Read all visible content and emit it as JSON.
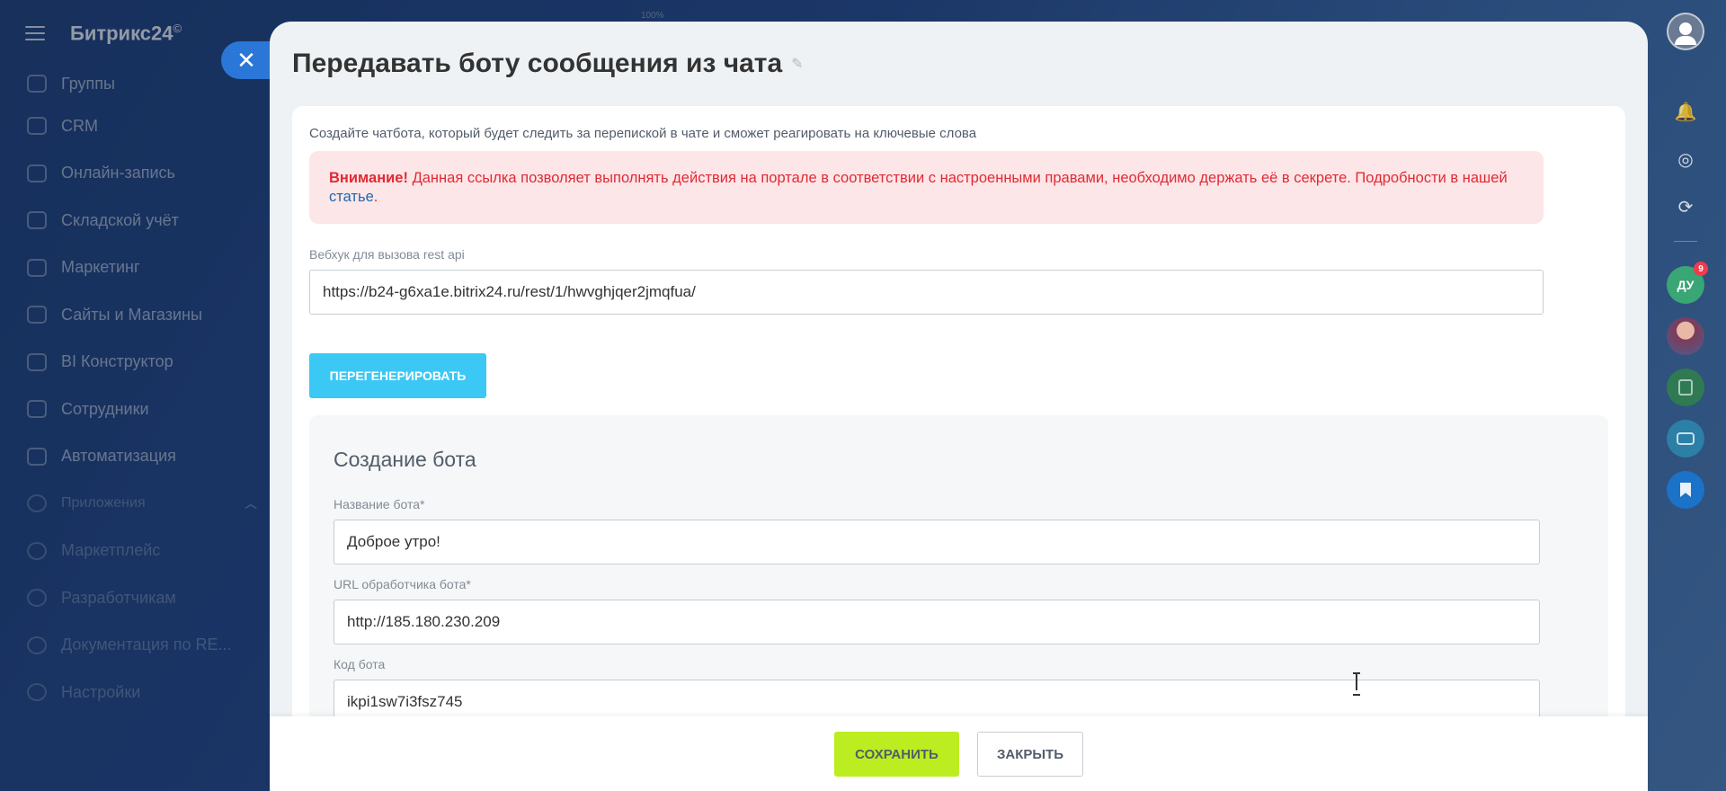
{
  "portal": {
    "logo": "Битрикс24",
    "logo_mark": "©",
    "zoom_label": "100%",
    "menu": [
      {
        "label": "Группы"
      },
      {
        "label": "CRM"
      },
      {
        "label": "Онлайн-запись"
      },
      {
        "label": "Складской учёт"
      },
      {
        "label": "Маркетинг"
      },
      {
        "label": "Сайты и Магазины"
      },
      {
        "label": "BI Конструктор"
      },
      {
        "label": "Сотрудники"
      },
      {
        "label": "Автоматизация"
      }
    ],
    "apps_section": "Приложения",
    "apps": [
      {
        "label": "Маркетплейс"
      },
      {
        "label": "Разработчикам"
      },
      {
        "label": "Документация по RE..."
      },
      {
        "label": "Настройки"
      }
    ],
    "rail": {
      "user_initials": "ДУ",
      "badge_count": "9"
    }
  },
  "slider": {
    "title": "Передавать боту сообщения из чата",
    "description": "Создайте чатбота, который будет следить за перепиской в чате и сможет реагировать на ключевые слова",
    "alert": {
      "strong": "Внимание!",
      "text": " Данная ссылка позволяет выполнять действия на портале в соответствии с настроенными правами, необходимо держать её в секрете. Подробности в нашей ",
      "link": "статье",
      "end": "."
    },
    "webhook": {
      "label": "Вебхук для вызова rest api",
      "value": "https://b24-g6xa1e.bitrix24.ru/rest/1/hwvghjqer2jmqfua/"
    },
    "regen_button": "ПЕРЕГЕНЕРИРОВАТЬ",
    "bot_section": {
      "title": "Создание бота",
      "name_label": "Название бота*",
      "name_value": "Доброе утро!",
      "url_label": "URL обработчика бота*",
      "url_value": "http://185.180.230.209",
      "code_label": "Код бота",
      "code_value": "ikpi1sw7i3fsz745"
    }
  },
  "footer": {
    "save": "СОХРАНИТЬ",
    "close": "ЗАКРЫТЬ"
  },
  "colors": {
    "accent_blue": "#2a77d8",
    "regen_button": "#3bc8f5",
    "save_button": "#bbed21",
    "alert_bg": "#fde6e8",
    "alert_text": "#e12a33"
  }
}
